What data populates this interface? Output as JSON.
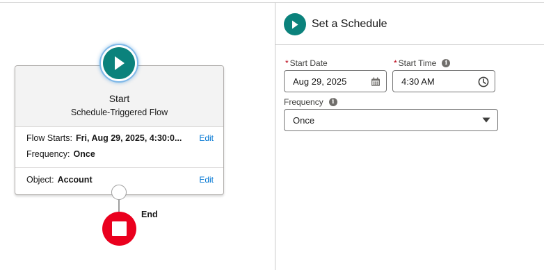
{
  "canvas": {
    "start": {
      "title": "Start",
      "subtitle": "Schedule-Triggered Flow",
      "flow_starts_label": "Flow Starts:",
      "flow_starts_value": "Fri, Aug 29, 2025, 4:30:0...",
      "frequency_label": "Frequency:",
      "frequency_value": "Once",
      "object_label": "Object:",
      "object_value": "Account",
      "edit_label": "Edit",
      "icon": "play-icon",
      "color": "#0b827c"
    },
    "end": {
      "label": "End",
      "icon": "stop-icon",
      "color": "#ea001e"
    }
  },
  "panel": {
    "title": "Set a Schedule",
    "icon": "play-icon",
    "start_date": {
      "required_mark": "*",
      "label": "Start Date",
      "value": "Aug 29, 2025",
      "icon": "calendar-icon"
    },
    "start_time": {
      "required_mark": "*",
      "label": "Start Time",
      "value": "4:30 AM",
      "icon": "clock-icon",
      "help_icon": "info-icon"
    },
    "frequency": {
      "label": "Frequency",
      "value": "Once",
      "icon": "chevron-down-icon",
      "help_icon": "info-icon"
    },
    "info_glyph": "i"
  }
}
